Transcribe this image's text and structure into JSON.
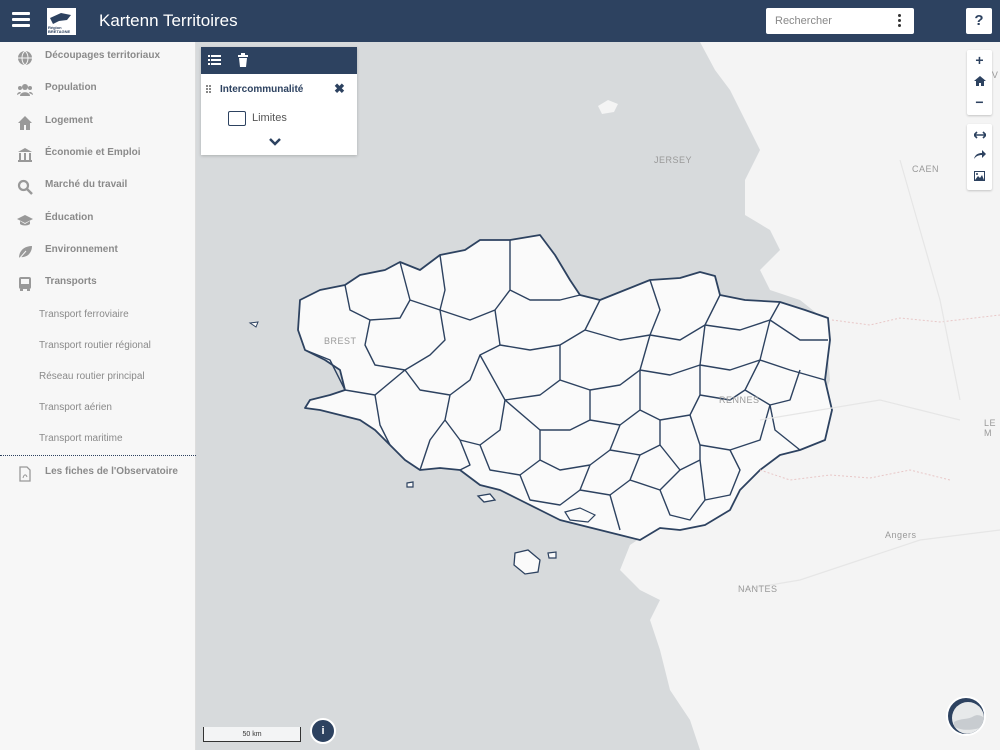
{
  "header": {
    "app_title": "Kartenn Territoires",
    "logo_text": "Région BRETAGNE",
    "search_placeholder": "Rechercher",
    "help_label": "?"
  },
  "sidebar": {
    "items": [
      {
        "label": "Découpages territoriaux",
        "icon": "globe-icon"
      },
      {
        "label": "Population",
        "icon": "users-icon"
      },
      {
        "label": "Logement",
        "icon": "home-icon"
      },
      {
        "label": "Économie et Emploi",
        "icon": "bank-icon"
      },
      {
        "label": "Marché du travail",
        "icon": "search-icon"
      },
      {
        "label": "Éducation",
        "icon": "graduation-cap-icon"
      },
      {
        "label": "Environnement",
        "icon": "leaf-icon"
      },
      {
        "label": "Transports",
        "icon": "bus-icon"
      }
    ],
    "sub_items": [
      {
        "label": "Transport ferroviaire"
      },
      {
        "label": "Transport routier régional"
      },
      {
        "label": "Réseau routier principal"
      },
      {
        "label": "Transport aérien"
      },
      {
        "label": "Transport maritime"
      }
    ],
    "fiches": {
      "label": "Les fiches de l'Observatoire",
      "icon": "pdf-file-icon"
    }
  },
  "layer_panel": {
    "layer_name": "Intercommunalité",
    "legend_item": "Limites"
  },
  "map": {
    "labels": {
      "jersey": "JERSEY",
      "caen": "CAEN",
      "brest": "BREST",
      "rennes": "RENNES",
      "angers": "Angers",
      "nantes": "NANTES",
      "le_mans": "LE M",
      "av": "AV"
    },
    "scale_label": "50 km",
    "info_label": "i"
  },
  "controls": {
    "zoom_in": "+",
    "zoom_out": "−"
  },
  "colors": {
    "brand": "#2d4260",
    "sea": "#d7dadc",
    "land": "#f4f4f4"
  }
}
